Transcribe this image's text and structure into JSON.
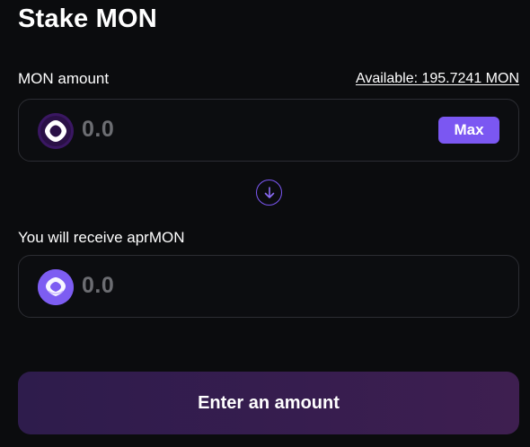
{
  "header": {
    "title": "Stake MON"
  },
  "input": {
    "label": "MON amount",
    "available": "Available: 195.7241 MON",
    "value": "0.0",
    "max_label": "Max",
    "token_icon": "mon-token-icon"
  },
  "output": {
    "label": "You will receive aprMON",
    "value": "0.0",
    "token_icon": "aprmon-token-icon"
  },
  "swap_icon": "arrow-down-icon",
  "cta": {
    "label": "Enter an amount"
  },
  "colors": {
    "accent": "#7b57f2",
    "background": "#0b0c0e",
    "field_border": "#2c2d33",
    "placeholder_text": "#6c6d72",
    "cta_gradient_start": "#2e1c4c",
    "cta_gradient_end": "#3e1f50"
  }
}
